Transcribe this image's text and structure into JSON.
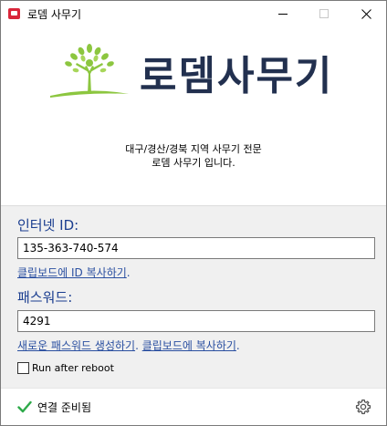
{
  "window": {
    "title": "로뎀 사무기"
  },
  "branding": {
    "logo_text": "로뎀사무기",
    "tagline_line1": "대구/경산/경북 지역 사무기 전문",
    "tagline_line2": "로뎀 사무기 입니다."
  },
  "internet_id": {
    "label": "인터넷 ID:",
    "value": "135-363-740-574",
    "copy_link": "클립보드에 ID 복사하기",
    "copy_link_suffix": "."
  },
  "password": {
    "label": "패스워드:",
    "value": "4291",
    "generate_link": "새로운 패스워드 생성하기",
    "separator": ". ",
    "copy_link": "클립보드에 복사하기",
    "copy_link_suffix": "."
  },
  "options": {
    "run_after_reboot_label": "Run after reboot",
    "run_after_reboot_checked": false
  },
  "status": {
    "text": "연결 준비됨",
    "icon": "check-icon",
    "settings_icon": "gear-icon"
  },
  "colors": {
    "brand_navy": "#22304f",
    "tree_green": "#8cc63f",
    "link_blue": "#2a4fa0",
    "label_blue": "#1a3d8f",
    "status_green": "#2eaa4a",
    "app_icon_red": "#d9263a"
  }
}
